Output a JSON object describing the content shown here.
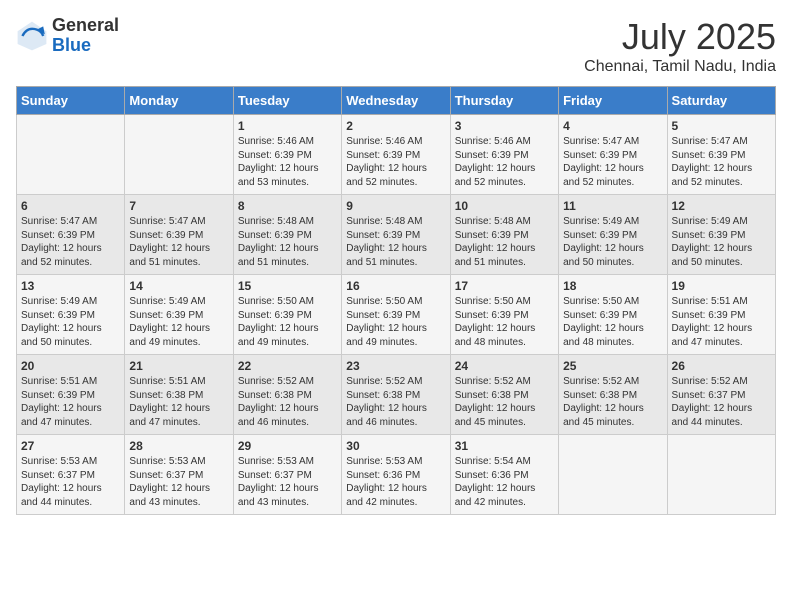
{
  "header": {
    "logo_general": "General",
    "logo_blue": "Blue",
    "month_title": "July 2025",
    "location": "Chennai, Tamil Nadu, India"
  },
  "days_of_week": [
    "Sunday",
    "Monday",
    "Tuesday",
    "Wednesday",
    "Thursday",
    "Friday",
    "Saturday"
  ],
  "weeks": [
    [
      {
        "day": "",
        "sunrise": "",
        "sunset": "",
        "daylight": ""
      },
      {
        "day": "",
        "sunrise": "",
        "sunset": "",
        "daylight": ""
      },
      {
        "day": "1",
        "sunrise": "Sunrise: 5:46 AM",
        "sunset": "Sunset: 6:39 PM",
        "daylight": "Daylight: 12 hours and 53 minutes."
      },
      {
        "day": "2",
        "sunrise": "Sunrise: 5:46 AM",
        "sunset": "Sunset: 6:39 PM",
        "daylight": "Daylight: 12 hours and 52 minutes."
      },
      {
        "day": "3",
        "sunrise": "Sunrise: 5:46 AM",
        "sunset": "Sunset: 6:39 PM",
        "daylight": "Daylight: 12 hours and 52 minutes."
      },
      {
        "day": "4",
        "sunrise": "Sunrise: 5:47 AM",
        "sunset": "Sunset: 6:39 PM",
        "daylight": "Daylight: 12 hours and 52 minutes."
      },
      {
        "day": "5",
        "sunrise": "Sunrise: 5:47 AM",
        "sunset": "Sunset: 6:39 PM",
        "daylight": "Daylight: 12 hours and 52 minutes."
      }
    ],
    [
      {
        "day": "6",
        "sunrise": "Sunrise: 5:47 AM",
        "sunset": "Sunset: 6:39 PM",
        "daylight": "Daylight: 12 hours and 52 minutes."
      },
      {
        "day": "7",
        "sunrise": "Sunrise: 5:47 AM",
        "sunset": "Sunset: 6:39 PM",
        "daylight": "Daylight: 12 hours and 51 minutes."
      },
      {
        "day": "8",
        "sunrise": "Sunrise: 5:48 AM",
        "sunset": "Sunset: 6:39 PM",
        "daylight": "Daylight: 12 hours and 51 minutes."
      },
      {
        "day": "9",
        "sunrise": "Sunrise: 5:48 AM",
        "sunset": "Sunset: 6:39 PM",
        "daylight": "Daylight: 12 hours and 51 minutes."
      },
      {
        "day": "10",
        "sunrise": "Sunrise: 5:48 AM",
        "sunset": "Sunset: 6:39 PM",
        "daylight": "Daylight: 12 hours and 51 minutes."
      },
      {
        "day": "11",
        "sunrise": "Sunrise: 5:49 AM",
        "sunset": "Sunset: 6:39 PM",
        "daylight": "Daylight: 12 hours and 50 minutes."
      },
      {
        "day": "12",
        "sunrise": "Sunrise: 5:49 AM",
        "sunset": "Sunset: 6:39 PM",
        "daylight": "Daylight: 12 hours and 50 minutes."
      }
    ],
    [
      {
        "day": "13",
        "sunrise": "Sunrise: 5:49 AM",
        "sunset": "Sunset: 6:39 PM",
        "daylight": "Daylight: 12 hours and 50 minutes."
      },
      {
        "day": "14",
        "sunrise": "Sunrise: 5:49 AM",
        "sunset": "Sunset: 6:39 PM",
        "daylight": "Daylight: 12 hours and 49 minutes."
      },
      {
        "day": "15",
        "sunrise": "Sunrise: 5:50 AM",
        "sunset": "Sunset: 6:39 PM",
        "daylight": "Daylight: 12 hours and 49 minutes."
      },
      {
        "day": "16",
        "sunrise": "Sunrise: 5:50 AM",
        "sunset": "Sunset: 6:39 PM",
        "daylight": "Daylight: 12 hours and 49 minutes."
      },
      {
        "day": "17",
        "sunrise": "Sunrise: 5:50 AM",
        "sunset": "Sunset: 6:39 PM",
        "daylight": "Daylight: 12 hours and 48 minutes."
      },
      {
        "day": "18",
        "sunrise": "Sunrise: 5:50 AM",
        "sunset": "Sunset: 6:39 PM",
        "daylight": "Daylight: 12 hours and 48 minutes."
      },
      {
        "day": "19",
        "sunrise": "Sunrise: 5:51 AM",
        "sunset": "Sunset: 6:39 PM",
        "daylight": "Daylight: 12 hours and 47 minutes."
      }
    ],
    [
      {
        "day": "20",
        "sunrise": "Sunrise: 5:51 AM",
        "sunset": "Sunset: 6:39 PM",
        "daylight": "Daylight: 12 hours and 47 minutes."
      },
      {
        "day": "21",
        "sunrise": "Sunrise: 5:51 AM",
        "sunset": "Sunset: 6:38 PM",
        "daylight": "Daylight: 12 hours and 47 minutes."
      },
      {
        "day": "22",
        "sunrise": "Sunrise: 5:52 AM",
        "sunset": "Sunset: 6:38 PM",
        "daylight": "Daylight: 12 hours and 46 minutes."
      },
      {
        "day": "23",
        "sunrise": "Sunrise: 5:52 AM",
        "sunset": "Sunset: 6:38 PM",
        "daylight": "Daylight: 12 hours and 46 minutes."
      },
      {
        "day": "24",
        "sunrise": "Sunrise: 5:52 AM",
        "sunset": "Sunset: 6:38 PM",
        "daylight": "Daylight: 12 hours and 45 minutes."
      },
      {
        "day": "25",
        "sunrise": "Sunrise: 5:52 AM",
        "sunset": "Sunset: 6:38 PM",
        "daylight": "Daylight: 12 hours and 45 minutes."
      },
      {
        "day": "26",
        "sunrise": "Sunrise: 5:52 AM",
        "sunset": "Sunset: 6:37 PM",
        "daylight": "Daylight: 12 hours and 44 minutes."
      }
    ],
    [
      {
        "day": "27",
        "sunrise": "Sunrise: 5:53 AM",
        "sunset": "Sunset: 6:37 PM",
        "daylight": "Daylight: 12 hours and 44 minutes."
      },
      {
        "day": "28",
        "sunrise": "Sunrise: 5:53 AM",
        "sunset": "Sunset: 6:37 PM",
        "daylight": "Daylight: 12 hours and 43 minutes."
      },
      {
        "day": "29",
        "sunrise": "Sunrise: 5:53 AM",
        "sunset": "Sunset: 6:37 PM",
        "daylight": "Daylight: 12 hours and 43 minutes."
      },
      {
        "day": "30",
        "sunrise": "Sunrise: 5:53 AM",
        "sunset": "Sunset: 6:36 PM",
        "daylight": "Daylight: 12 hours and 42 minutes."
      },
      {
        "day": "31",
        "sunrise": "Sunrise: 5:54 AM",
        "sunset": "Sunset: 6:36 PM",
        "daylight": "Daylight: 12 hours and 42 minutes."
      },
      {
        "day": "",
        "sunrise": "",
        "sunset": "",
        "daylight": ""
      },
      {
        "day": "",
        "sunrise": "",
        "sunset": "",
        "daylight": ""
      }
    ]
  ]
}
